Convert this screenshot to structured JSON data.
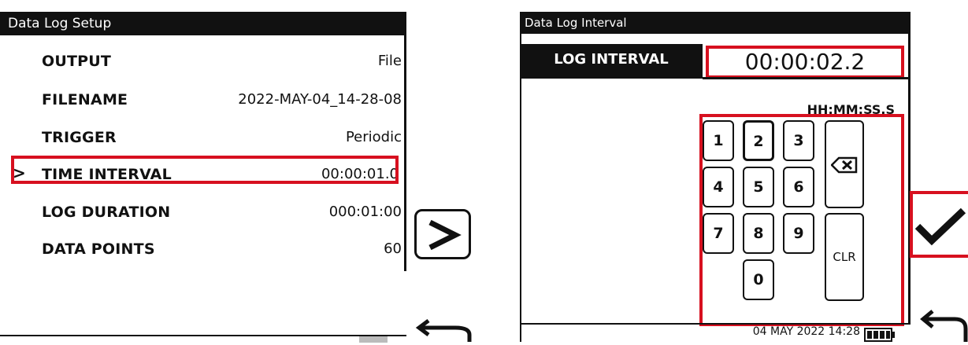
{
  "setup_screen": {
    "title": "Data Log Setup",
    "rows": [
      {
        "label": "OUTPUT",
        "value": "File"
      },
      {
        "label": "FILENAME",
        "value": "2022-MAY-04_14-28-08"
      },
      {
        "label": "TRIGGER",
        "value": "Periodic"
      },
      {
        "label": "TIME INTERVAL",
        "value": "00:00:01.0",
        "selected": true
      },
      {
        "label": "LOG DURATION",
        "value": "000:01:00"
      },
      {
        "label": "DATA POINTS",
        "value": "60"
      }
    ],
    "selected_marker": ">"
  },
  "interval_screen": {
    "title": "Data Log Interval",
    "label": "LOG INTERVAL",
    "value": "00:00:02.2",
    "format_hint": "HH:MM:SS.S",
    "keys": [
      "1",
      "2",
      "3",
      "4",
      "5",
      "6",
      "7",
      "8",
      "9",
      "0"
    ],
    "focused_key": "2",
    "clear_label": "CLR",
    "backspace_icon": "backspace-icon",
    "status_date": "04 MAY 2022 14:28"
  },
  "nav": {
    "next_icon": "chevron-right-icon",
    "back_icon": "return-arrow-icon",
    "confirm_icon": "checkmark-icon"
  },
  "colors": {
    "highlight": "#d7101f",
    "screen_fg": "#111111",
    "screen_bg": "#ffffff"
  }
}
